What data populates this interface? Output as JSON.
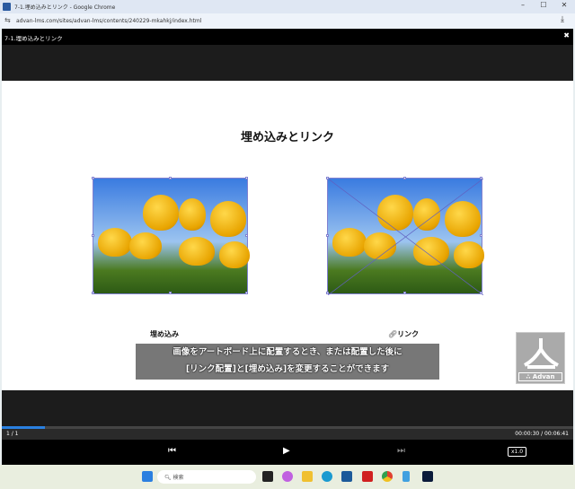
{
  "window": {
    "title": "7-1.埋め込みとリンク - Google Chrome",
    "minimize": "–",
    "maximize": "☐",
    "close": "✕"
  },
  "address": {
    "url": "advan-lms.com/sites/advan-lms/contents/240229-mkahkj/index.html"
  },
  "player": {
    "title": "7-1.埋め込みとリンク",
    "close": "✖",
    "slide": {
      "title": "埋め込みとリンク",
      "embed_caption": "埋め込み",
      "link_caption": "リンク",
      "subtitle_line1": "画像をアートボード上に配置するとき、または配置した後に",
      "subtitle_line2": "[リンク配置]と[埋め込み]を変更することができます"
    },
    "logo": "Advan",
    "page": "1 / 1",
    "time": "00:00:30 / 00:06:41",
    "progress_percent": 7.5,
    "speed": "x1.0"
  },
  "taskbar": {
    "search_placeholder": "検索"
  },
  "colors": {
    "accent": "#2a80e0",
    "selection": "#8080d0"
  }
}
